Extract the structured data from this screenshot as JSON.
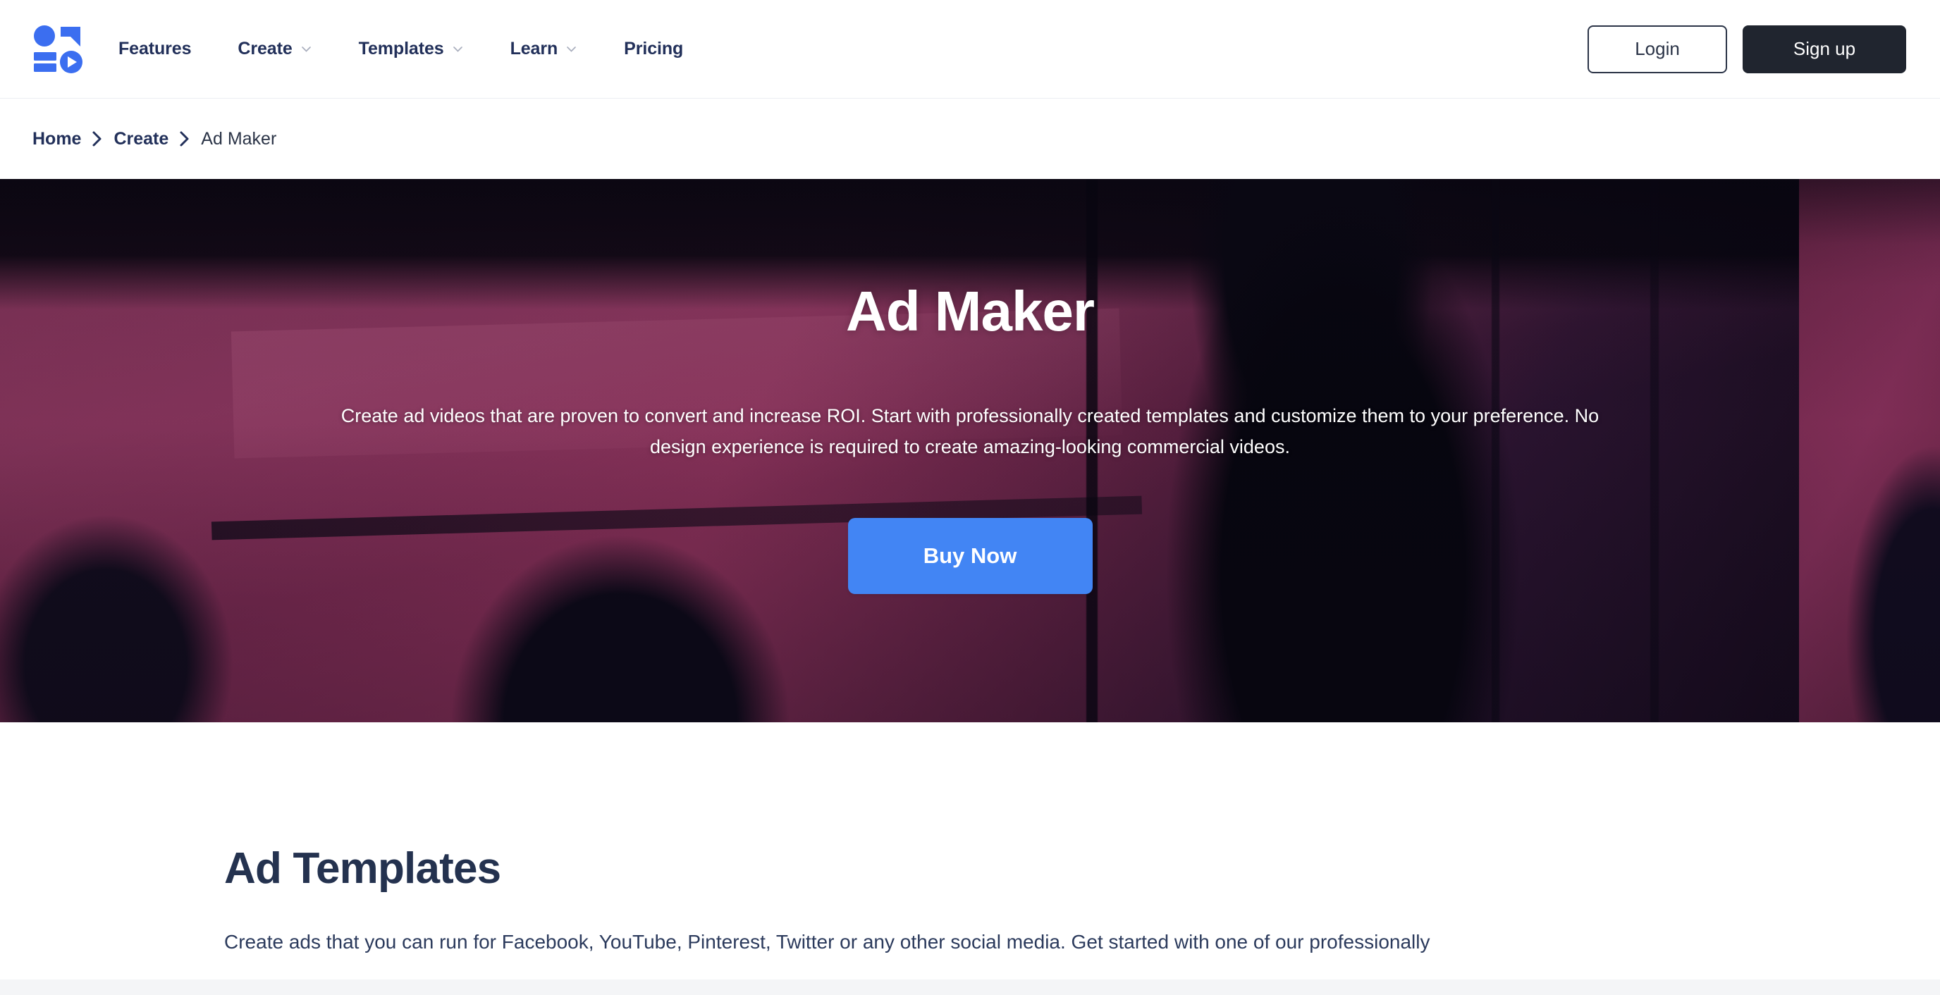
{
  "brand": {
    "logo_icon": "logo-grid-play-icon",
    "accent_blue": "#4285f4",
    "navy": "#22305a",
    "dark": "#20252f"
  },
  "header": {
    "nav": [
      {
        "label": "Features",
        "has_dropdown": false,
        "icon": ""
      },
      {
        "label": "Create",
        "has_dropdown": true,
        "icon": "chevron-down-icon"
      },
      {
        "label": "Templates",
        "has_dropdown": true,
        "icon": "chevron-down-icon"
      },
      {
        "label": "Learn",
        "has_dropdown": true,
        "icon": "chevron-down-icon"
      },
      {
        "label": "Pricing",
        "has_dropdown": false,
        "icon": ""
      }
    ],
    "login_label": "Login",
    "signup_label": "Sign up"
  },
  "breadcrumb": {
    "separator_icon": "chevron-right-icon",
    "items": [
      {
        "label": "Home",
        "current": false
      },
      {
        "label": "Create",
        "current": false
      },
      {
        "label": "Ad Maker",
        "current": true
      }
    ]
  },
  "hero": {
    "title": "Ad Maker",
    "subtitle": "Create ad videos that are proven to convert and increase ROI. Start with professionally created templates and customize them to your preference. No design experience is required to create amazing-looking commercial videos.",
    "cta_label": "Buy Now",
    "overlay_color": "#7c2b52",
    "background_description": "film-set-photo-duotone-magenta"
  },
  "templates_section": {
    "title": "Ad Templates",
    "text": "Create ads that you can run for Facebook, YouTube, Pinterest, Twitter or any other social media. Get started with one of our professionally"
  }
}
